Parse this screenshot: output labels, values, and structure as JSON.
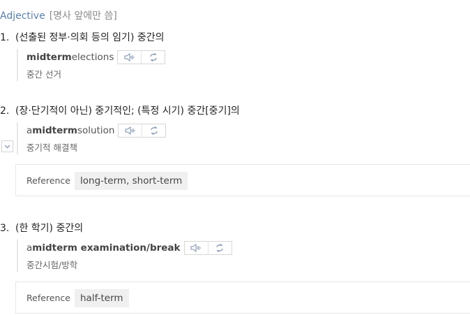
{
  "pos": {
    "label": "Adjective",
    "note": "[명사 앞에만 씀]"
  },
  "senses": [
    {
      "number": "1.",
      "definition": "(선출된 정부·의회 등의 임기) 중간의",
      "example": {
        "pre": "",
        "bold": "midterm",
        "post": " elections",
        "translation": "중간 선거"
      }
    },
    {
      "number": "2.",
      "definition": "(장·단기적이 아닌) 중기적인; (특정 시기) 중간[중기]의",
      "example": {
        "pre": "a ",
        "bold": "midterm",
        "post": " solution",
        "translation": "중기적 해결책"
      },
      "reference": {
        "label": "Reference",
        "value": "long-term, short-term"
      }
    },
    {
      "number": "3.",
      "definition": "(한 학기) 중간의",
      "example": {
        "pre": "a ",
        "bold": "midterm examination/break",
        "post": "",
        "translation": "중간시험/방학"
      },
      "reference": {
        "label": "Reference",
        "value": "half-term"
      }
    }
  ],
  "icons": {
    "audio": "speaker-icon",
    "repeat": "repeat-icon",
    "expand": "chevron-down-icon"
  },
  "colors": {
    "pos_label": "#5b7fa6",
    "icon": "#7a8ea8"
  }
}
